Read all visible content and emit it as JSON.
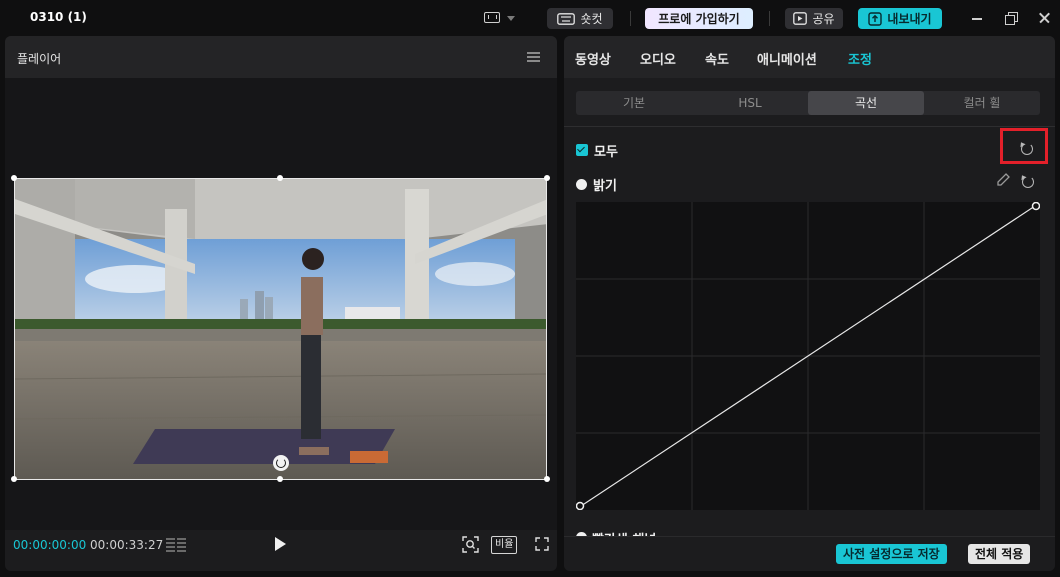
{
  "titlebar": {
    "app_title": "0310 (1)",
    "shortcut_label": "숏컷",
    "pro_label": "프로에 가입하기",
    "share_label": "공유",
    "export_label": "내보내기",
    "accent_color": "#19c6d4"
  },
  "player": {
    "title": "플레이어",
    "current_time": "00:00:00:00",
    "total_time": "00:00:33:27",
    "ratio_label": "비율"
  },
  "panel": {
    "tabs": [
      {
        "label": "동영상",
        "active": false
      },
      {
        "label": "오디오",
        "active": false
      },
      {
        "label": "속도",
        "active": false
      },
      {
        "label": "애니메이션",
        "active": false
      },
      {
        "label": "조정",
        "active": true
      }
    ],
    "subtabs": [
      {
        "label": "기본",
        "active": false
      },
      {
        "label": "HSL",
        "active": false
      },
      {
        "label": "곡선",
        "active": true
      },
      {
        "label": "컬러 휠",
        "active": false
      }
    ],
    "all_label": "모두",
    "all_checked": true,
    "brightness_label": "밝기",
    "next_channel_label": "빨간색 채널",
    "curve": {
      "points": [
        [
          0,
          0
        ],
        [
          1,
          1
        ]
      ]
    },
    "save_preset_label": "사전 설정으로 저장",
    "apply_all_label": "전체 적용"
  }
}
